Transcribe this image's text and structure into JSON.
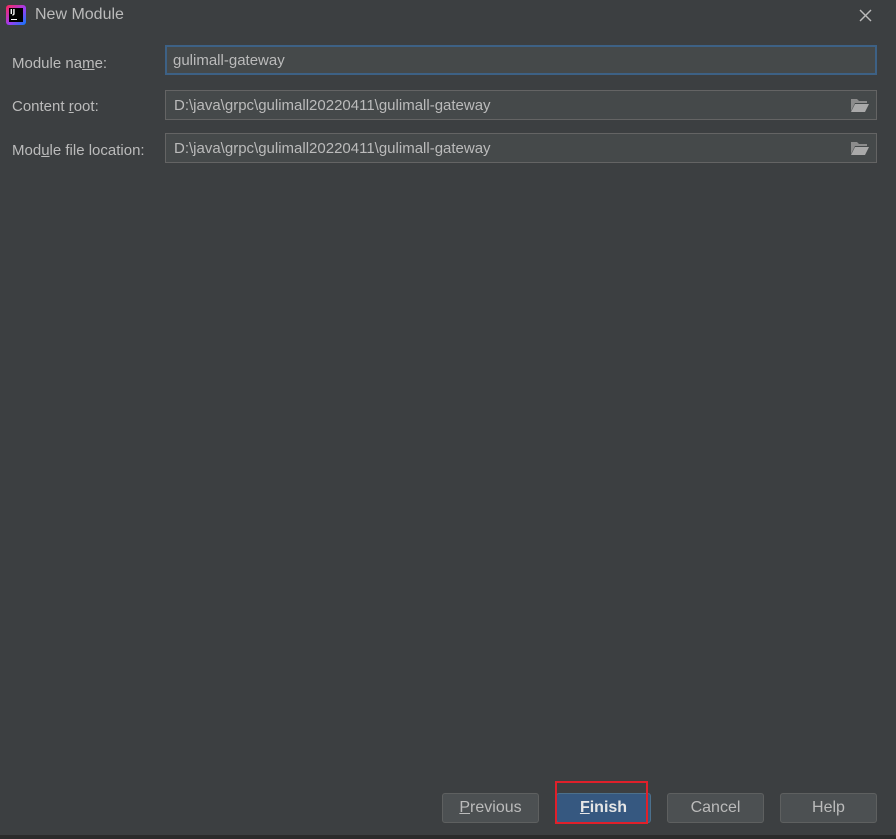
{
  "window": {
    "title": "New Module",
    "app_icon": "intellij-idea-icon",
    "close_icon": "close-icon"
  },
  "form": {
    "module_name": {
      "label_pre": "Module na",
      "label_mnemonic": "m",
      "label_post": "e:",
      "value": "gulimall-gateway"
    },
    "content_root": {
      "label_pre": "Content ",
      "label_mnemonic": "r",
      "label_post": "oot:",
      "value": "D:\\java\\grpc\\gulimall20220411\\gulimall-gateway",
      "browse_icon": "folder-open-icon"
    },
    "module_file_location": {
      "label_pre": "Mod",
      "label_mnemonic": "u",
      "label_post": "le file location:",
      "value": "D:\\java\\grpc\\gulimall20220411\\gulimall-gateway",
      "browse_icon": "folder-open-icon"
    }
  },
  "buttons": {
    "previous": {
      "mnemonic": "P",
      "rest": "revious"
    },
    "finish": {
      "mnemonic": "F",
      "rest": "inish"
    },
    "cancel": {
      "label": "Cancel"
    },
    "help": {
      "label": "Help"
    }
  },
  "colors": {
    "background": "#3c3f41",
    "field_background": "#45494a",
    "focus_border": "#3d6185",
    "default_button": "#365880",
    "annotation_highlight": "#e0202a"
  }
}
